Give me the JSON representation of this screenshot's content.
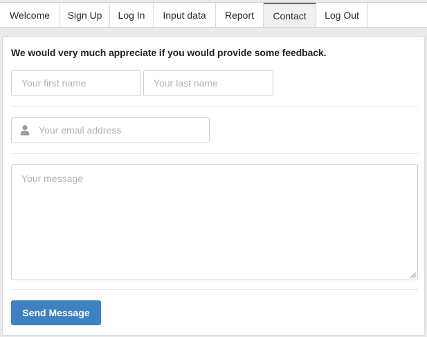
{
  "nav": {
    "tabs": [
      {
        "label": "Welcome"
      },
      {
        "label": "Sign Up"
      },
      {
        "label": "Log In"
      },
      {
        "label": "Input data"
      },
      {
        "label": "Report"
      },
      {
        "label": "Contact",
        "active": true
      },
      {
        "label": "Log Out"
      }
    ]
  },
  "form": {
    "heading": "We would very much appreciate if you would provide some feedback.",
    "first_name": {
      "value": "",
      "placeholder": "Your first name"
    },
    "last_name": {
      "value": "",
      "placeholder": "Your last name"
    },
    "email": {
      "value": "",
      "placeholder": "Your email address",
      "icon": "user-icon"
    },
    "message": {
      "value": "",
      "placeholder": "Your message"
    },
    "send_label": "Send Message"
  },
  "colors": {
    "accent": "#3d81c0",
    "active_tab_bg": "#f0f0f0",
    "border": "#cfcfcf"
  }
}
